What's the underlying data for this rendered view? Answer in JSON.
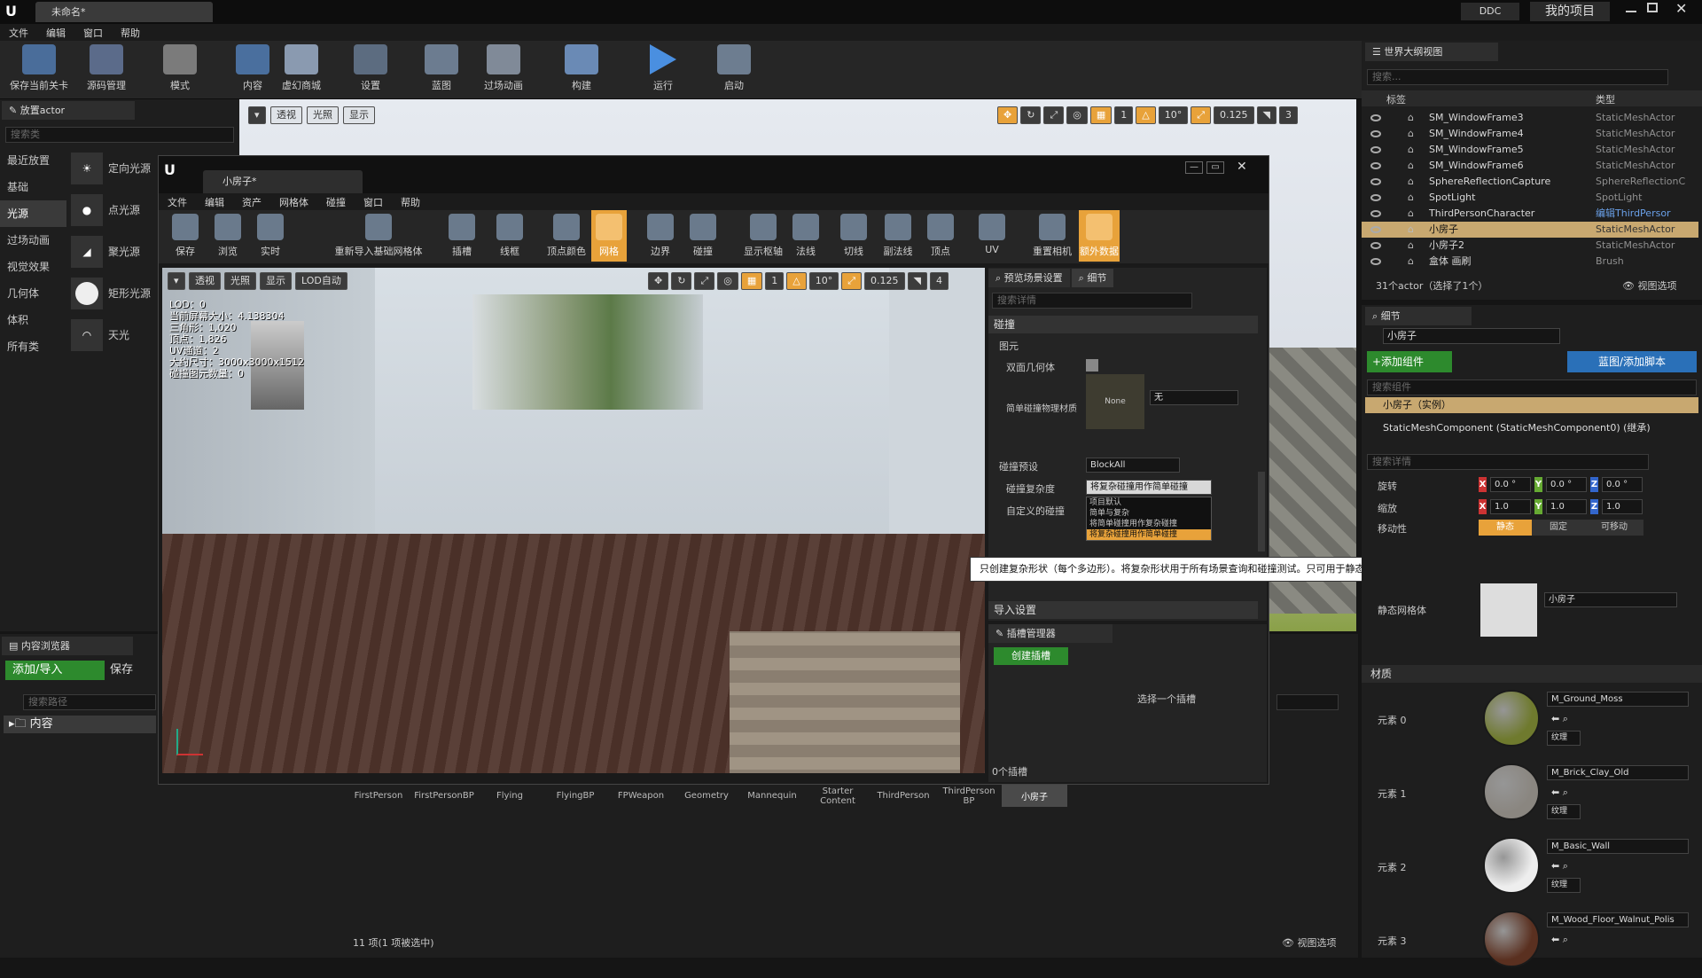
{
  "topbar": {
    "project_tab": "未命名*",
    "ddc_label": "DDC",
    "project_button": "我的项目"
  },
  "menu": [
    "文件",
    "编辑",
    "窗口",
    "帮助"
  ],
  "toolbar": [
    {
      "label": "保存当前关卡",
      "icon": "save-icon"
    },
    {
      "label": "源码管理",
      "icon": "source-control-icon"
    },
    {
      "label": "模式",
      "icon": "modes-icon"
    },
    {
      "label": "内容",
      "icon": "content-icon"
    },
    {
      "label": "虚幻商城",
      "icon": "marketplace-icon"
    },
    {
      "label": "设置",
      "icon": "settings-icon"
    },
    {
      "label": "蓝图",
      "icon": "blueprint-icon"
    },
    {
      "label": "过场动画",
      "icon": "cinematics-icon"
    },
    {
      "label": "构建",
      "icon": "build-icon"
    },
    {
      "label": "运行",
      "icon": "play-icon"
    },
    {
      "label": "启动",
      "icon": "launch-icon"
    }
  ],
  "place_panel": {
    "title": "放置actor",
    "search_placeholder": "搜索类",
    "categories": [
      "最近放置",
      "基础",
      "光源",
      "过场动画",
      "视觉效果",
      "几何体",
      "体积",
      "所有类"
    ],
    "active_category": "光源",
    "lights": [
      "定向光源",
      "点光源",
      "聚光源",
      "矩形光源",
      "天光"
    ]
  },
  "level_viewport": {
    "buttons": [
      "透视",
      "光照",
      "显示"
    ],
    "snap": [
      "1",
      "10°",
      "0.125",
      "3"
    ]
  },
  "mesh_editor": {
    "tab": "小房子*",
    "menu": [
      "文件",
      "编辑",
      "资产",
      "网格体",
      "碰撞",
      "窗口",
      "帮助"
    ],
    "toolbar": [
      {
        "label": "保存",
        "icon": "save-icon"
      },
      {
        "label": "浏览",
        "icon": "browse-icon"
      },
      {
        "label": "实时",
        "icon": "realtime-icon"
      },
      {
        "label": "重新导入基础网格体",
        "icon": "reimport-icon"
      },
      {
        "label": "插槽",
        "icon": "socket-icon"
      },
      {
        "label": "线框",
        "icon": "wireframe-icon"
      },
      {
        "label": "顶点颜色",
        "icon": "vertex-color-icon"
      },
      {
        "label": "网格",
        "icon": "grid-icon",
        "active": true
      },
      {
        "label": "边界",
        "icon": "bounds-icon"
      },
      {
        "label": "碰撞",
        "icon": "collision-icon"
      },
      {
        "label": "显示枢轴",
        "icon": "pivot-icon"
      },
      {
        "label": "法线",
        "icon": "normals-icon"
      },
      {
        "label": "切线",
        "icon": "tangents-icon"
      },
      {
        "label": "副法线",
        "icon": "binormals-icon"
      },
      {
        "label": "顶点",
        "icon": "vertices-icon"
      },
      {
        "label": "UV",
        "icon": "uv-icon"
      },
      {
        "label": "重置相机",
        "icon": "reset-camera-icon"
      },
      {
        "label": "额外数据",
        "icon": "additional-data-icon",
        "active": true
      }
    ],
    "viewport_buttons": [
      "透视",
      "光照",
      "显示",
      "LOD自动"
    ],
    "snap": [
      "1",
      "10°",
      "0.125",
      "4"
    ],
    "stats": [
      "LOD：0",
      "当前屏幕大小：4.138304",
      "三角形：1,020",
      "顶点：1,826",
      "UV通道：2",
      "大约尺寸：3000x3000x1512",
      "碰撞图元数量：0"
    ],
    "details": {
      "tabs": [
        "预览场景设置",
        "细节"
      ],
      "search_placeholder": "搜索详情",
      "collision_section": "碰撞",
      "primitives": "图元",
      "double_sided": "双面几何体",
      "phys_material_label": "简单碰撞物理材质",
      "phys_none": "None",
      "phys_value": "无",
      "preset_label": "碰撞预设",
      "preset_value": "BlockAll",
      "complexity_label": "碰撞复杂度",
      "complexity_value": "将复杂碰撞用作简单碰撞",
      "custom_label": "自定义的碰撞",
      "options": [
        "项目默认",
        "简单与复杂",
        "将简单碰撞用作复杂碰撞",
        "将复杂碰撞用作简单碰撞"
      ],
      "import_section": "导入设置"
    },
    "socket_manager": {
      "title": "插槽管理器",
      "create_button": "创建插槽",
      "empty_text": "选择一个插槽",
      "count": "0个插槽"
    }
  },
  "tooltip": "只创建复杂形状（每个多边形）。将复杂形状用于所有场景查询和碰撞测试。只可用于静态形状的模拟中（即可被碰撞，但无法通过力或速度来移动。）",
  "outliner": {
    "title": "世界大纲视图",
    "search_placeholder": "搜索...",
    "col_label": "标签",
    "col_type": "类型",
    "rows": [
      {
        "label": "SM_WindowFrame3",
        "type": "StaticMeshActor"
      },
      {
        "label": "SM_WindowFrame4",
        "type": "StaticMeshActor"
      },
      {
        "label": "SM_WindowFrame5",
        "type": "StaticMeshActor"
      },
      {
        "label": "SM_WindowFrame6",
        "type": "StaticMeshActor"
      },
      {
        "label": "SphereReflectionCapture",
        "type": "SphereReflectionC"
      },
      {
        "label": "SpotLight",
        "type": "SpotLight"
      },
      {
        "label": "ThirdPersonCharacter",
        "type": "编辑ThirdPersor"
      },
      {
        "label": "小房子",
        "type": "StaticMeshActor",
        "selected": true
      },
      {
        "label": "小房子2",
        "type": "StaticMeshActor"
      },
      {
        "label": "盒体 画刷",
        "type": "Brush"
      }
    ],
    "footer": "31个actor（选择了1个）",
    "view_options": "视图选项"
  },
  "details_panel": {
    "title": "细节",
    "name": "小房子",
    "add_component": "+添加组件",
    "blueprint_button": "蓝图/添加脚本",
    "search_placeholder": "搜索组件",
    "instance": "小房子（实例）",
    "component": "StaticMeshComponent (StaticMeshComponent0) (继承)",
    "search_details_placeholder": "搜索详情",
    "rotation_label": "旋转",
    "rotation": [
      "0.0 °",
      "0.0 °",
      "0.0 °"
    ],
    "scale_label": "缩放",
    "scale": [
      "1.0",
      "1.0",
      "1.0"
    ],
    "mobility_label": "移动性",
    "mobility": [
      "静态",
      "固定",
      "可移动"
    ],
    "static_mesh_label": "静态网格体",
    "static_mesh_value": "小房子",
    "materials_section": "材质",
    "materials": [
      {
        "slot": "元素 0",
        "name": "M_Ground_Moss",
        "color": "#6f7a2e"
      },
      {
        "slot": "元素 1",
        "name": "M_Brick_Clay_Old",
        "color": "#8a8680"
      },
      {
        "slot": "元素 2",
        "name": "M_Basic_Wall",
        "color": "#eeeeee"
      },
      {
        "slot": "元素 3",
        "name": "M_Wood_Floor_Walnut_Polis",
        "color": "#5a3020"
      }
    ],
    "texture_label": "纹理"
  },
  "content_browser": {
    "title": "内容浏览器",
    "add_import": "添加/导入",
    "save": "保存",
    "path_placeholder": "搜索路径",
    "root": "内容",
    "folders": [
      "FirstPerson",
      "FirstPersonBP",
      "Flying",
      "FlyingBP",
      "FPWeapon",
      "Geometry",
      "Mannequin",
      "Starter Content",
      "ThirdPerson",
      "ThirdPerson BP",
      "小房子"
    ],
    "footer": "11 项(1 项被选中)",
    "view_options": "视图选项"
  },
  "colors": {
    "accent": "#e8a23a",
    "selection": "#c8a870",
    "green": "#3c9c3c",
    "blue": "#2a70b8"
  }
}
